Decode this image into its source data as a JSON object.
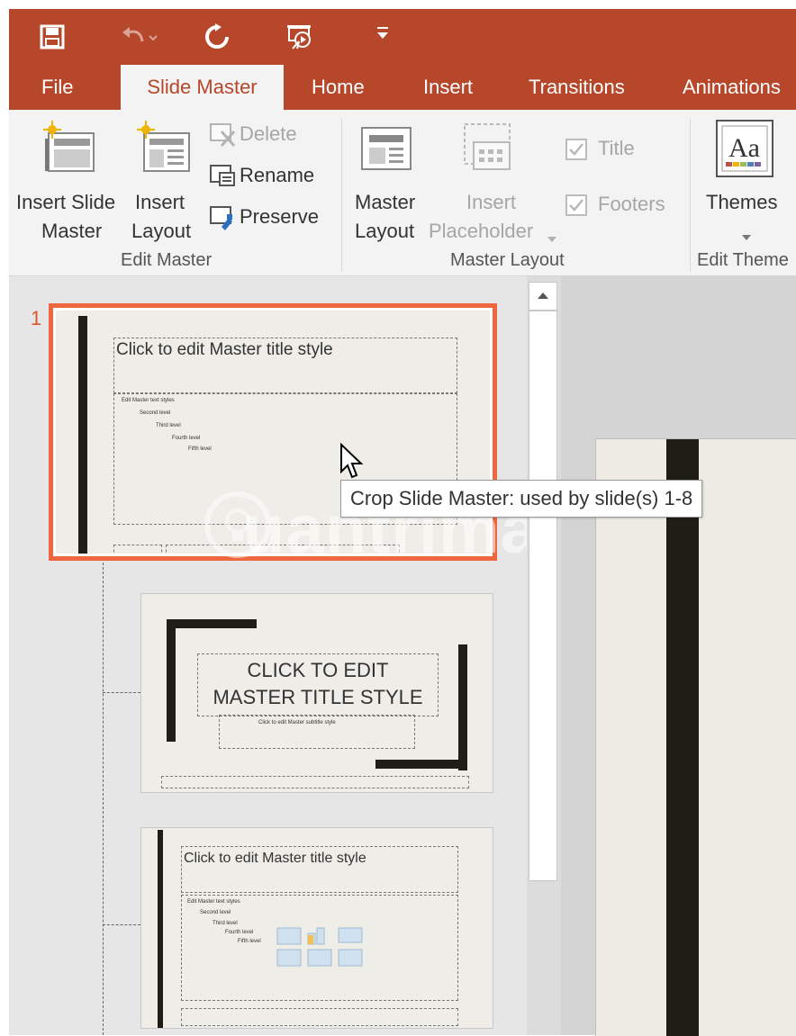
{
  "quick_access": {
    "save_icon": "save-icon",
    "undo_icon": "undo-icon",
    "redo_icon": "repeat-icon",
    "present_icon": "present-from-start-icon",
    "customize_icon": "customize-quick-access-icon"
  },
  "tabs": [
    "File",
    "Slide Master",
    "Home",
    "Insert",
    "Transitions",
    "Animations"
  ],
  "active_tab": "Slide Master",
  "ribbon": {
    "edit_master": {
      "insert_slide_master": [
        "Insert Slide",
        "Master"
      ],
      "insert_layout": [
        "Insert",
        "Layout"
      ],
      "delete": "Delete",
      "rename": "Rename",
      "preserve": "Preserve",
      "group_label": "Edit Master"
    },
    "master_layout": {
      "master_layout": [
        "Master",
        "Layout"
      ],
      "insert_placeholder": [
        "Insert",
        "Placeholder"
      ],
      "title_checkbox": "Title",
      "footers_checkbox": "Footers",
      "group_label": "Master Layout"
    },
    "edit_theme": {
      "themes": "Themes",
      "group_label": "Edit Theme"
    }
  },
  "slides": {
    "number": "1",
    "master": {
      "title": "Click to edit Master title style",
      "levels": [
        "Edit Master text styles",
        "Second level",
        "Third level",
        "Fourth level",
        "Fifth level"
      ]
    },
    "layout1": {
      "title_line1": "CLICK TO EDIT",
      "title_line2": "MASTER TITLE STYLE",
      "subtitle": "Click to edit Master subtitle style"
    },
    "layout2": {
      "title": "Click to edit Master title style",
      "levels": [
        "Edit Master text styles",
        "Second level",
        "Third level",
        "Fourth level",
        "Fifth level"
      ]
    }
  },
  "tooltip": "Crop Slide Master: used by slide(s) 1-8",
  "watermark": "uantrimang",
  "colors": {
    "accent": "#b7472a",
    "selection": "#f0663e"
  }
}
